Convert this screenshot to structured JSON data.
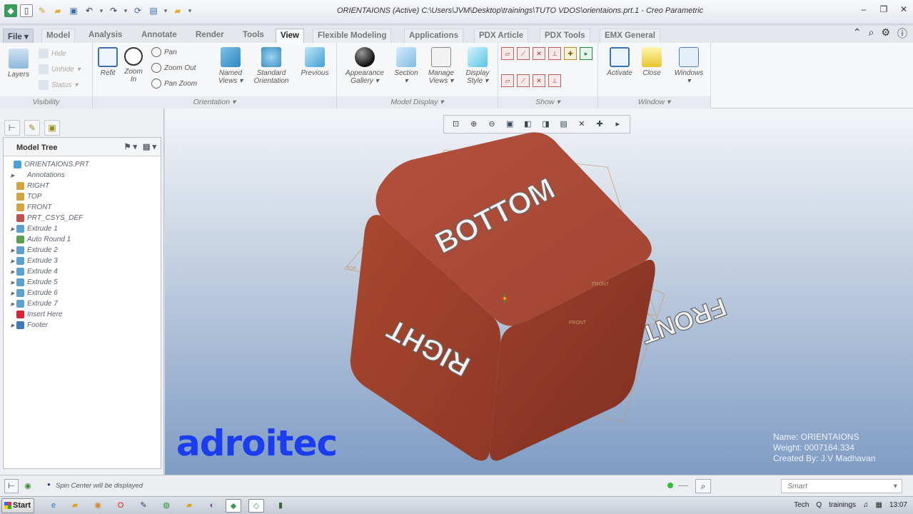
{
  "window": {
    "title": "ORIENTAIONS (Active) C:\\Users\\JVM\\Desktop\\trainings\\TUTO VDOS\\orientaions.prt.1 - Creo Parametric"
  },
  "tabs": [
    "File",
    "Model",
    "Analysis",
    "Annotate",
    "Render",
    "Tools",
    "View",
    "Flexible Modeling",
    "Applications",
    "PDX Article",
    "PDX Tools",
    "EMX General"
  ],
  "active_tab": "View",
  "ribbon": {
    "visibility": {
      "label": "Visibility",
      "layers": "Layers",
      "hide": "Hide",
      "unhide": "Unhide",
      "status": "Status"
    },
    "orientation": {
      "label": "Orientation",
      "refit": "Refit",
      "zoom_in": "Zoom In",
      "pan": "Pan",
      "zoom_out": "Zoom Out",
      "pan_zoom": "Pan Zoom",
      "named_views": "Named Views",
      "standard_orientation": "Standard Orientation",
      "previous": "Previous"
    },
    "model_display": {
      "label": "Model Display",
      "appearance_gallery": "Appearance Gallery",
      "section": "Section",
      "manage_views": "Manage Views",
      "display_style": "Display Style"
    },
    "show": {
      "label": "Show"
    },
    "window": {
      "label": "Window",
      "activate": "Activate",
      "close": "Close",
      "windows": "Windows"
    }
  },
  "model_tree": {
    "header": "Model Tree",
    "items": [
      {
        "label": "ORIENTAIONS.PRT",
        "icon": "part-icon",
        "expandable": false
      },
      {
        "label": "Annotations",
        "icon": "",
        "expandable": true
      },
      {
        "label": "RIGHT",
        "icon": "datum-plane-icon",
        "expandable": false
      },
      {
        "label": "TOP",
        "icon": "datum-plane-icon",
        "expandable": false
      },
      {
        "label": "FRONT",
        "icon": "datum-plane-icon",
        "expandable": false
      },
      {
        "label": "PRT_CSYS_DEF",
        "icon": "csys-icon",
        "expandable": false
      },
      {
        "label": "Extrude 1",
        "icon": "extrude-icon",
        "expandable": true
      },
      {
        "label": "Auto Round 1",
        "icon": "round-icon",
        "expandable": false
      },
      {
        "label": "Extrude 2",
        "icon": "extrude-icon",
        "expandable": true
      },
      {
        "label": "Extrude 3",
        "icon": "extrude-icon",
        "expandable": true
      },
      {
        "label": "Extrude 4",
        "icon": "extrude-icon",
        "expandable": true
      },
      {
        "label": "Extrude 5",
        "icon": "extrude-icon",
        "expandable": true
      },
      {
        "label": "Extrude 6",
        "icon": "extrude-icon",
        "expandable": true
      },
      {
        "label": "Extrude 7",
        "icon": "extrude-icon",
        "expandable": true
      },
      {
        "label": "Insert Here",
        "icon": "insert-arrow-icon",
        "expandable": false
      },
      {
        "label": "Footer",
        "icon": "footer-icon",
        "expandable": true
      }
    ]
  },
  "viewport": {
    "cube_faces": {
      "top": "BOTTOM",
      "left": "RIGHT",
      "right": "FRONT"
    },
    "datum_labels": {
      "top": "TOP",
      "front_a": "FRONT",
      "front_b": "FRONT"
    },
    "brand": "adroitec",
    "info": {
      "name": "Name: ORIENTAIONS",
      "weight": "Weight: 0007164.334",
      "created_by": "Created By: J.V Madhavan"
    },
    "colors": {
      "cube": "#b3503c",
      "background_top": "#f3f5f8",
      "background_bottom": "#7f9cc4",
      "brand": "#1b3df0"
    }
  },
  "status": {
    "message": "Spin Center will be displayed",
    "selection_filter": "Smart"
  },
  "taskbar": {
    "start": "Start",
    "tray": [
      "Tech",
      "Q",
      "trainings",
      "13:07"
    ]
  }
}
